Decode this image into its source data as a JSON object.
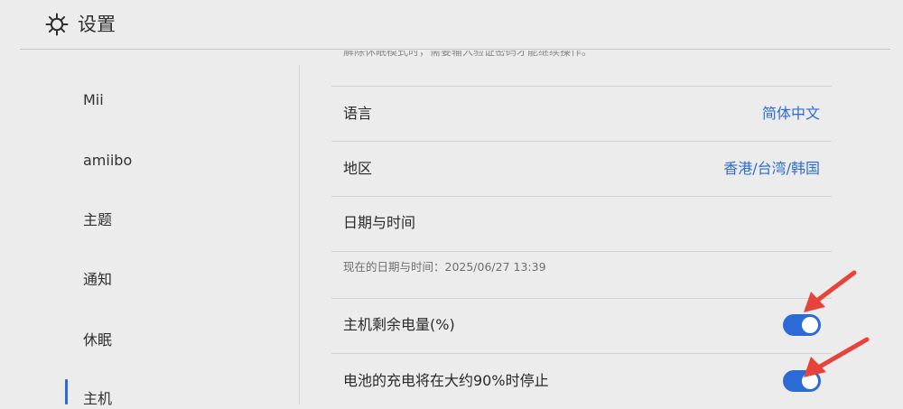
{
  "header": {
    "title": "设置",
    "icon": "gear-icon"
  },
  "sidebar": {
    "items": [
      {
        "label": "Mii"
      },
      {
        "label": "amiibo"
      },
      {
        "label": "主题"
      },
      {
        "label": "通知"
      },
      {
        "label": "休眠"
      },
      {
        "label": "主机",
        "selected": true
      }
    ]
  },
  "main": {
    "top_note": "解除休眠模式时，需要输入验证密码才能继续操作。",
    "rows": {
      "language": {
        "label": "语言",
        "value": "简体中文"
      },
      "region": {
        "label": "地区",
        "value": "香港/台湾/韩国"
      },
      "datetime": {
        "label": "日期与时间",
        "current": "现在的日期与时间：2025/06/27 13:39"
      },
      "battery_percent": {
        "label": "主机剩余电量(%)",
        "on": true
      },
      "battery_charge_limit": {
        "label": "电池的充电将在大约90%时停止",
        "on": true
      }
    }
  },
  "colors": {
    "accent": "#2c6bd6",
    "annotation_arrow": "#e8433a",
    "background": "#ececec"
  }
}
